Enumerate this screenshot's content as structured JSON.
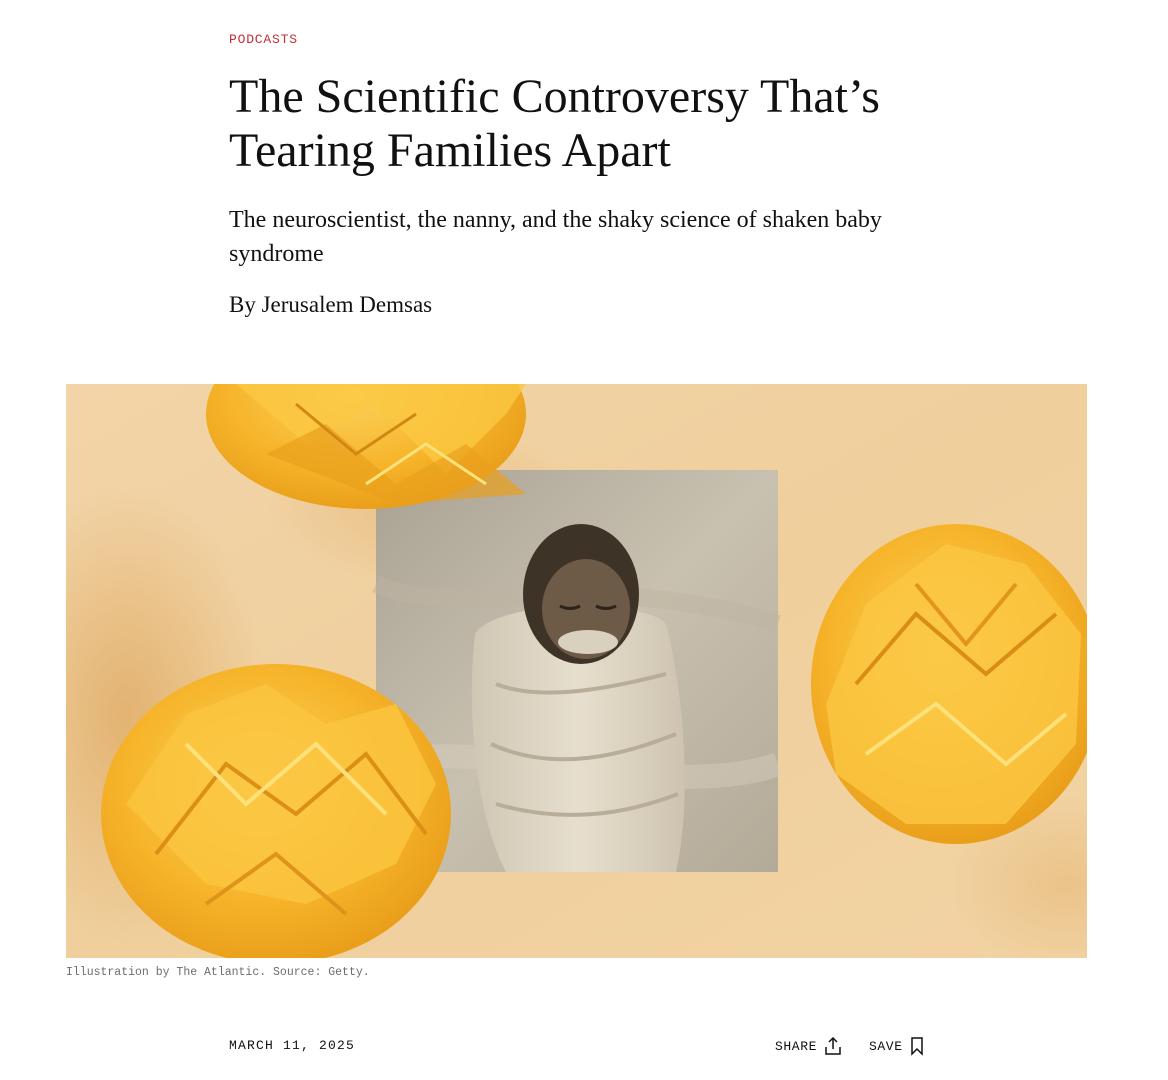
{
  "article": {
    "section": "PODCASTS",
    "title": "The Scientific Controversy That’s Tearing Families Apart",
    "dek": "The neuroscientist, the nanny, and the shaky science of shaken baby syndrome",
    "byline_prefix": "By ",
    "author": "Jerusalem Demsas",
    "caption": "Illustration by The Atlantic. Source: Getty.",
    "date": "MARCH 11, 2025"
  },
  "actions": {
    "share_label": "SHARE",
    "save_label": "SAVE",
    "share_icon": "share-upload-icon",
    "save_icon": "bookmark-icon"
  },
  "colors": {
    "section_accent": "#c2303a",
    "hero_background": "#efcf9e",
    "paper_ball": "#f6b52c"
  }
}
